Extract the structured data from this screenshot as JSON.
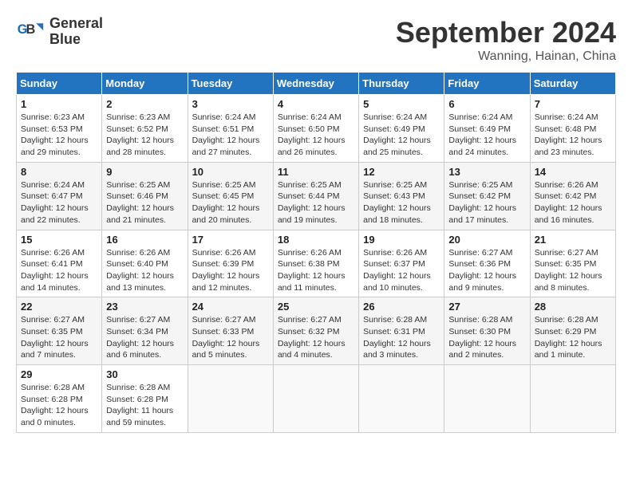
{
  "logo": {
    "line1": "General",
    "line2": "Blue"
  },
  "title": "September 2024",
  "location": "Wanning, Hainan, China",
  "weekdays": [
    "Sunday",
    "Monday",
    "Tuesday",
    "Wednesday",
    "Thursday",
    "Friday",
    "Saturday"
  ],
  "weeks": [
    [
      {
        "day": "1",
        "info": "Sunrise: 6:23 AM\nSunset: 6:53 PM\nDaylight: 12 hours\nand 29 minutes."
      },
      {
        "day": "2",
        "info": "Sunrise: 6:23 AM\nSunset: 6:52 PM\nDaylight: 12 hours\nand 28 minutes."
      },
      {
        "day": "3",
        "info": "Sunrise: 6:24 AM\nSunset: 6:51 PM\nDaylight: 12 hours\nand 27 minutes."
      },
      {
        "day": "4",
        "info": "Sunrise: 6:24 AM\nSunset: 6:50 PM\nDaylight: 12 hours\nand 26 minutes."
      },
      {
        "day": "5",
        "info": "Sunrise: 6:24 AM\nSunset: 6:49 PM\nDaylight: 12 hours\nand 25 minutes."
      },
      {
        "day": "6",
        "info": "Sunrise: 6:24 AM\nSunset: 6:49 PM\nDaylight: 12 hours\nand 24 minutes."
      },
      {
        "day": "7",
        "info": "Sunrise: 6:24 AM\nSunset: 6:48 PM\nDaylight: 12 hours\nand 23 minutes."
      }
    ],
    [
      {
        "day": "8",
        "info": "Sunrise: 6:24 AM\nSunset: 6:47 PM\nDaylight: 12 hours\nand 22 minutes."
      },
      {
        "day": "9",
        "info": "Sunrise: 6:25 AM\nSunset: 6:46 PM\nDaylight: 12 hours\nand 21 minutes."
      },
      {
        "day": "10",
        "info": "Sunrise: 6:25 AM\nSunset: 6:45 PM\nDaylight: 12 hours\nand 20 minutes."
      },
      {
        "day": "11",
        "info": "Sunrise: 6:25 AM\nSunset: 6:44 PM\nDaylight: 12 hours\nand 19 minutes."
      },
      {
        "day": "12",
        "info": "Sunrise: 6:25 AM\nSunset: 6:43 PM\nDaylight: 12 hours\nand 18 minutes."
      },
      {
        "day": "13",
        "info": "Sunrise: 6:25 AM\nSunset: 6:42 PM\nDaylight: 12 hours\nand 17 minutes."
      },
      {
        "day": "14",
        "info": "Sunrise: 6:26 AM\nSunset: 6:42 PM\nDaylight: 12 hours\nand 16 minutes."
      }
    ],
    [
      {
        "day": "15",
        "info": "Sunrise: 6:26 AM\nSunset: 6:41 PM\nDaylight: 12 hours\nand 14 minutes."
      },
      {
        "day": "16",
        "info": "Sunrise: 6:26 AM\nSunset: 6:40 PM\nDaylight: 12 hours\nand 13 minutes."
      },
      {
        "day": "17",
        "info": "Sunrise: 6:26 AM\nSunset: 6:39 PM\nDaylight: 12 hours\nand 12 minutes."
      },
      {
        "day": "18",
        "info": "Sunrise: 6:26 AM\nSunset: 6:38 PM\nDaylight: 12 hours\nand 11 minutes."
      },
      {
        "day": "19",
        "info": "Sunrise: 6:26 AM\nSunset: 6:37 PM\nDaylight: 12 hours\nand 10 minutes."
      },
      {
        "day": "20",
        "info": "Sunrise: 6:27 AM\nSunset: 6:36 PM\nDaylight: 12 hours\nand 9 minutes."
      },
      {
        "day": "21",
        "info": "Sunrise: 6:27 AM\nSunset: 6:35 PM\nDaylight: 12 hours\nand 8 minutes."
      }
    ],
    [
      {
        "day": "22",
        "info": "Sunrise: 6:27 AM\nSunset: 6:35 PM\nDaylight: 12 hours\nand 7 minutes."
      },
      {
        "day": "23",
        "info": "Sunrise: 6:27 AM\nSunset: 6:34 PM\nDaylight: 12 hours\nand 6 minutes."
      },
      {
        "day": "24",
        "info": "Sunrise: 6:27 AM\nSunset: 6:33 PM\nDaylight: 12 hours\nand 5 minutes."
      },
      {
        "day": "25",
        "info": "Sunrise: 6:27 AM\nSunset: 6:32 PM\nDaylight: 12 hours\nand 4 minutes."
      },
      {
        "day": "26",
        "info": "Sunrise: 6:28 AM\nSunset: 6:31 PM\nDaylight: 12 hours\nand 3 minutes."
      },
      {
        "day": "27",
        "info": "Sunrise: 6:28 AM\nSunset: 6:30 PM\nDaylight: 12 hours\nand 2 minutes."
      },
      {
        "day": "28",
        "info": "Sunrise: 6:28 AM\nSunset: 6:29 PM\nDaylight: 12 hours\nand 1 minute."
      }
    ],
    [
      {
        "day": "29",
        "info": "Sunrise: 6:28 AM\nSunset: 6:28 PM\nDaylight: 12 hours\nand 0 minutes."
      },
      {
        "day": "30",
        "info": "Sunrise: 6:28 AM\nSunset: 6:28 PM\nDaylight: 11 hours\nand 59 minutes."
      },
      {
        "day": "",
        "info": ""
      },
      {
        "day": "",
        "info": ""
      },
      {
        "day": "",
        "info": ""
      },
      {
        "day": "",
        "info": ""
      },
      {
        "day": "",
        "info": ""
      }
    ]
  ]
}
